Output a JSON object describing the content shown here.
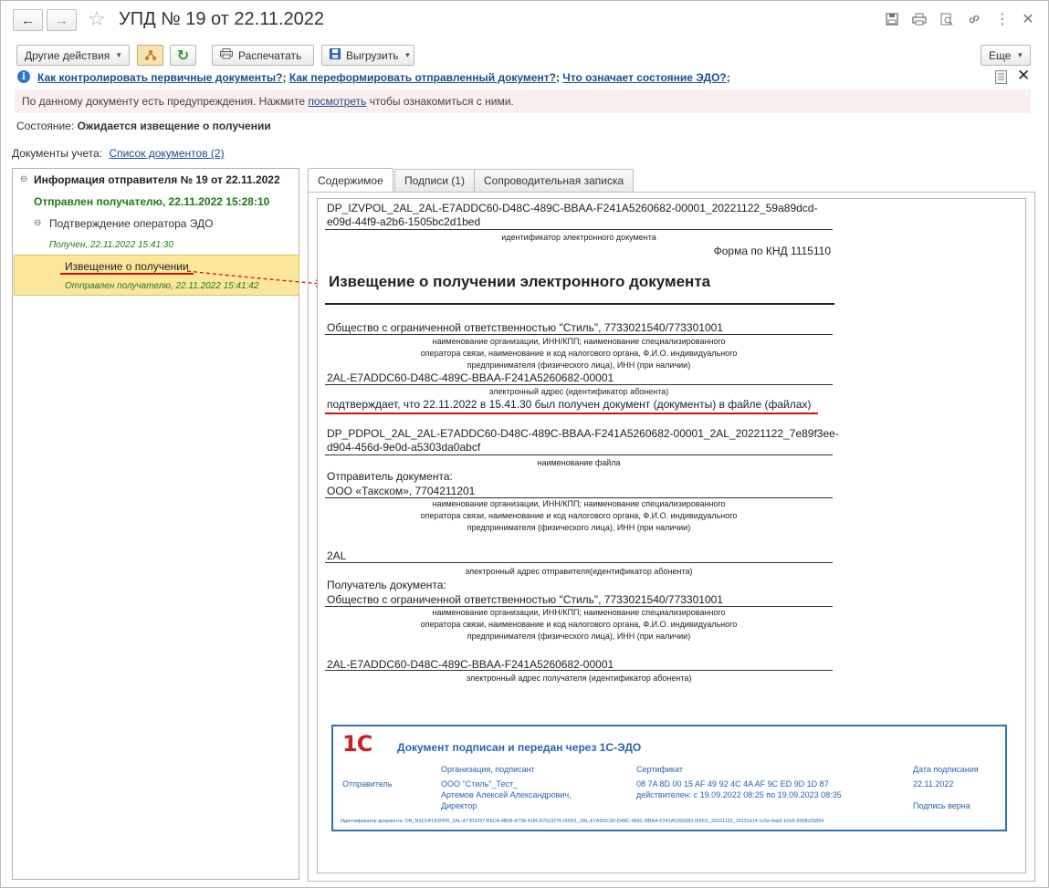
{
  "window": {
    "title": "УПД № 19 от 22.11.2022"
  },
  "toolbar": {
    "other_actions": "Другие действия",
    "print": "Распечатать",
    "export": "Выгрузить",
    "more": "Еще"
  },
  "help_links": {
    "link1": "Как контролировать первичные документы?",
    "sep1": ";",
    "link2": "Как переформировать отправленный документ?",
    "sep2": ";",
    "link3": "Что означает состояние ЭДО?",
    "sep3": ";"
  },
  "warning": {
    "before": "По данному документу есть предупреждения. Нажмите",
    "link": "посмотреть",
    "after": "чтобы ознакомиться с ними."
  },
  "state": {
    "label": "Состояние:",
    "value": "Ожидается извещение о получении"
  },
  "accounting": {
    "label": "Документы учета:",
    "link": "Список документов (2)"
  },
  "tree": {
    "root": "Информация отправителя № 19 от 22.11.2022",
    "root_status": "Отправлен получателю, 22.11.2022 15:28:10",
    "child": "Подтверждение оператора ЭДО",
    "child_status": "Получен, 22.11.2022 15:41:30",
    "selected": "Извещение о получении",
    "selected_status": "Отправлен получателю, 22.11.2022 15:41:42"
  },
  "tabs": [
    "Содержимое",
    "Подписи (1)",
    "Сопроводительная записка"
  ],
  "document": {
    "file_id_line1": "DP_IZVPOL_2AL_2AL-E7ADDC60-D48C-489C-BBAA-F241A5260682-00001_20221122_59a89dcd-",
    "file_id_line2": "e09d-44f9-a2b6-1505bc2d1bed",
    "file_id_caption": "идентификатор электронного документа",
    "form": "Форма по КНД 1115110",
    "heading": "Извещение о получении электронного документа",
    "org": "Общество с ограниченной ответственностью \"Стиль\", 7733021540/773301001",
    "org_caption_1": "наименование организации, ИНН/КПП; наименование специализированного",
    "org_caption_2": "оператора связи, наименование и код налогового органа, Ф.И.О. индивидуального",
    "org_caption_3": "предпринимателя (физического лица), ИНН (при наличии)",
    "address": "2AL-E7ADDC60-D48C-489C-BBAA-F241A5260682-00001",
    "address_caption": "электронный адрес (идентификатор абонента)",
    "confirm": "подтверждает, что 22.11.2022 в 15.41.30 был получен документ (документы) в файле (файлах)",
    "file_name_line1": "DP_PDPOL_2AL_2AL-E7ADDC60-D48C-489C-BBAA-F241A5260682-00001_2AL_20221122_7e89f3ee-",
    "file_name_line2": "d904-456d-9e0d-a5303da0abcf",
    "file_name_caption": "наименование файла",
    "sender_label": "Отправитель документа:",
    "sender": "ООО «Такском», 7704211201",
    "sender_caption_1": "наименование организации, ИНН/КПП; наименование специализированного",
    "sender_caption_2": "оператора связи, наименование и код налогового органа, Ф.И.О. индивидуального",
    "sender_caption_3": "предпринимателя (физического лица), ИНН (при наличии)",
    "sender_address": "2AL",
    "sender_address_caption": "электронный адрес отправителя(идентификатор абонента)",
    "recipient_label": "Получатель документа:",
    "recipient": "Общество с ограниченной ответственностью \"Стиль\", 7733021540/773301001",
    "recipient_caption_1": "наименование организации, ИНН/КПП; наименование специализированного",
    "recipient_caption_2": "оператора связи, наименование и код налогового органа, Ф.И.О. индивидуального",
    "recipient_caption_3": "предпринимателя (физического лица), ИНН (при наличии)",
    "recipient_address": "2AL-E7ADDC60-D48C-489C-BBAA-F241A5260682-00001",
    "recipient_address_caption": "электронный адрес получателя (идентификатор абонента)"
  },
  "stamp": {
    "logo": "1С",
    "title": "Документ подписан и передан через 1С-ЭДО",
    "col_org": "Организация, подписант",
    "col_cert": "Сертификат",
    "col_date": "Дата подписания",
    "row_label": "Отправитель",
    "org_1": "ООО \"Стиль\"_Тест_",
    "org_2": "Артемов Алексей Александрович,",
    "org_3": "Директор",
    "cert_1": "08 7A 8D 00 15 AF 49 92 4C 4A AF 9C ED 9D 1D 87",
    "cert_2": "действителен: с 19.09.2022 08:25 по 19.09.2023 08:35",
    "date": "22.11.2022",
    "signature": "Подпись верна",
    "doc_id": "Идентификатор документа: ON_NSCHFDOPPR_2AL-A7303297-B6CA-4B06-A738-418CA7619276-00001_2AL-E7ADDC60-D48C-489C-BBAA-F241A5260682-00001_20221122_15231d14-1c5e-4ab2-b2e5-5008c55884"
  },
  "colors": {
    "accent_green": "#1e7b14",
    "link_blue": "#1a4e8a",
    "selection_yellow": "#fbe69a",
    "annotation_red": "#c81414",
    "stamp_blue": "#2f6fb3"
  }
}
